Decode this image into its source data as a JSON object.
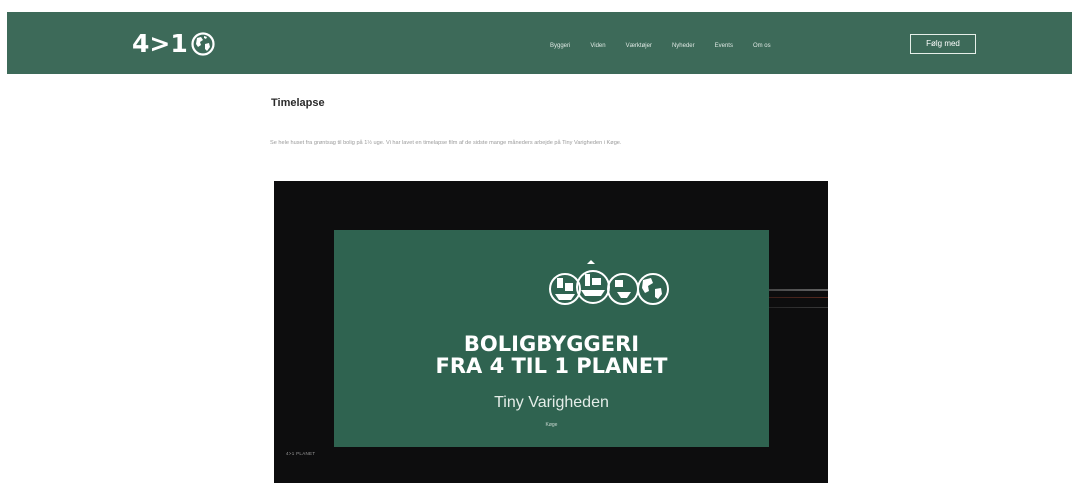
{
  "header": {
    "logo_text": "4>1",
    "logo_icon": "globe-icon",
    "nav": [
      "Byggeri",
      "Viden",
      "Værktøjer",
      "Nyheder",
      "Events",
      "Om os"
    ],
    "cta_label": "Følg med",
    "background": "#3d6a59"
  },
  "main": {
    "title": "Timelapse",
    "description": "Se hele huset fra grøntsag til bolig på 1½ uge. Vi har lavet en timelapse film af de sidste mange måneders arbejde på Tiny Varigheden i Køge.",
    "video": {
      "card_headline_1": "BOLIGBYGGERI",
      "card_headline_2": "FRA 4 TIL 1 PLANET",
      "card_subtitle": "Tiny Varigheden",
      "card_small": "Køge",
      "card_color": "#2f6350",
      "watermark": "4>1 PLANET"
    }
  }
}
